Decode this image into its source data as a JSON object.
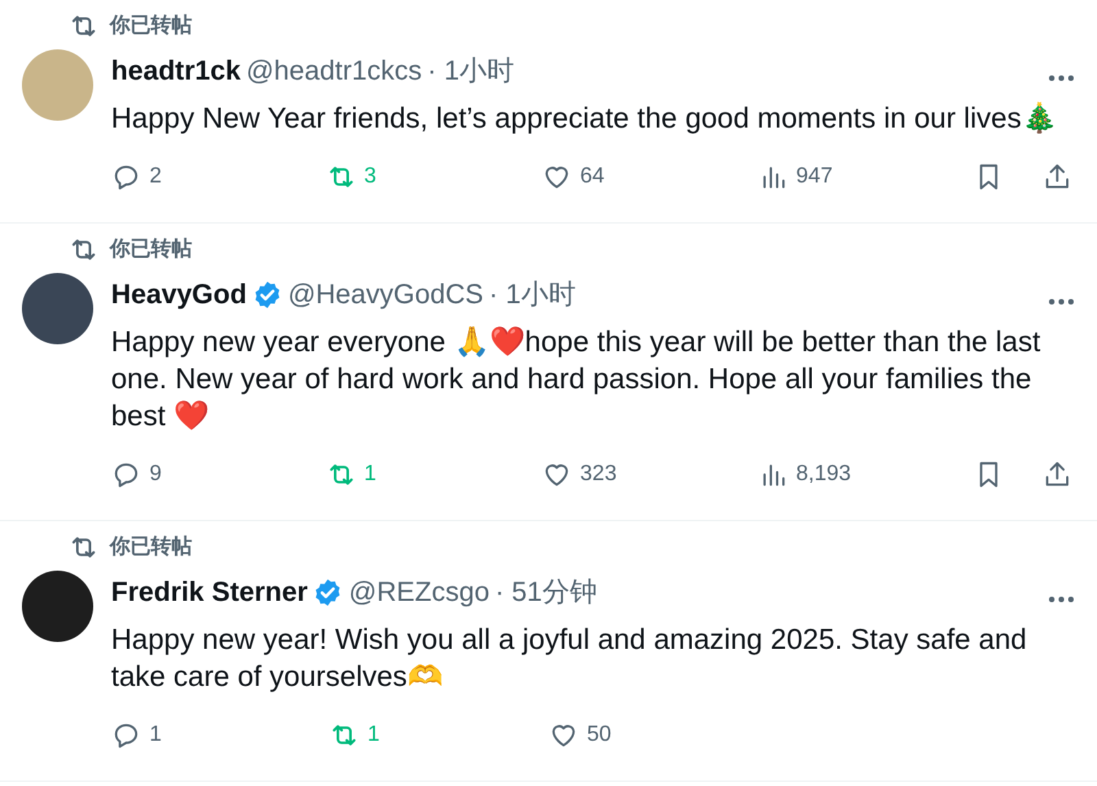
{
  "posts": [
    {
      "repost_label": "你已转帖",
      "name": "headtr1ck",
      "verified": false,
      "handle": "@headtr1ckcs",
      "time": "· 1小时",
      "text": "Happy New Year friends, let’s appreciate the good moments in our lives🎄",
      "replies": "2",
      "reposts": "3",
      "reposted": true,
      "likes": "64",
      "views": "947"
    },
    {
      "repost_label": "你已转帖",
      "name": "HeavyGod",
      "verified": true,
      "handle": "@HeavyGodCS",
      "time": "· 1小时",
      "text": "Happy new year everyone 🙏❤️hope this year will be better than the last one.  New year of hard work and hard passion. Hope all your families the best ❤️",
      "replies": "9",
      "reposts": "1",
      "reposted": true,
      "likes": "323",
      "views": "8,193"
    },
    {
      "repost_label": "你已转帖",
      "name": "Fredrik Sterner",
      "verified": true,
      "handle": "@REZcsgo",
      "time": "· 51分钟",
      "text": "Happy new year! Wish you all a joyful and amazing 2025. Stay safe and take care of yourselves🫶",
      "replies": "1",
      "reposts": "1",
      "reposted": true,
      "likes": "50"
    }
  ]
}
